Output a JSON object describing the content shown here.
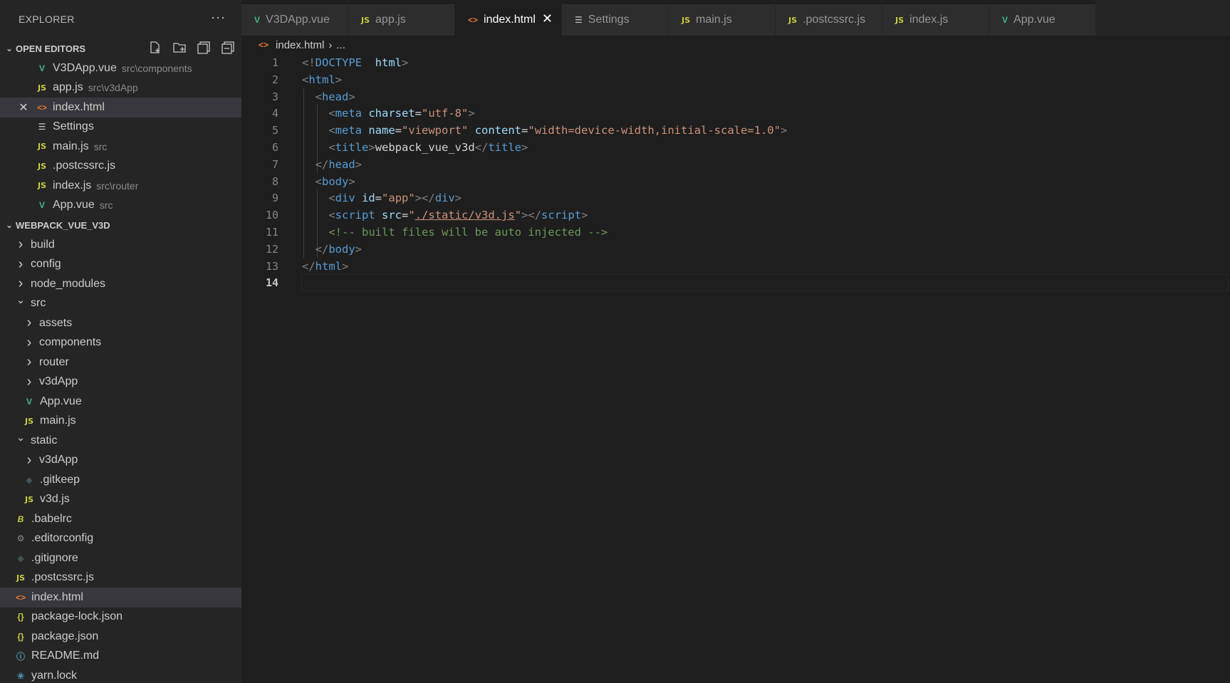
{
  "explorer": {
    "title": "EXPLORER",
    "more_label": "···",
    "open_editors": {
      "title": "OPEN EDITORS",
      "items": [
        {
          "name": "V3DApp.vue",
          "desc": "src\\components",
          "icon": "vue-icon"
        },
        {
          "name": "app.js",
          "desc": "src\\v3dApp",
          "icon": "js-icon"
        },
        {
          "name": "index.html",
          "desc": "",
          "icon": "html-icon",
          "selected": true
        },
        {
          "name": "Settings",
          "desc": "",
          "icon": "settings-icon"
        },
        {
          "name": "main.js",
          "desc": "src",
          "icon": "js-icon"
        },
        {
          "name": ".postcssrc.js",
          "desc": "",
          "icon": "js-icon"
        },
        {
          "name": "index.js",
          "desc": "src\\router",
          "icon": "js-icon"
        },
        {
          "name": "App.vue",
          "desc": "src",
          "icon": "vue-icon"
        }
      ]
    },
    "project": {
      "title": "WEBPACK_VUE_V3D",
      "tree": [
        {
          "name": "build",
          "type": "folder",
          "expanded": false,
          "depth": 0
        },
        {
          "name": "config",
          "type": "folder",
          "expanded": false,
          "depth": 0
        },
        {
          "name": "node_modules",
          "type": "folder",
          "expanded": false,
          "depth": 0
        },
        {
          "name": "src",
          "type": "folder",
          "expanded": true,
          "depth": 0
        },
        {
          "name": "assets",
          "type": "folder",
          "expanded": false,
          "depth": 1
        },
        {
          "name": "components",
          "type": "folder",
          "expanded": false,
          "depth": 1
        },
        {
          "name": "router",
          "type": "folder",
          "expanded": false,
          "depth": 1
        },
        {
          "name": "v3dApp",
          "type": "folder",
          "expanded": false,
          "depth": 1
        },
        {
          "name": "App.vue",
          "type": "file",
          "icon": "vue-icon",
          "depth": 1
        },
        {
          "name": "main.js",
          "type": "file",
          "icon": "js-icon",
          "depth": 1
        },
        {
          "name": "static",
          "type": "folder",
          "expanded": true,
          "depth": 0
        },
        {
          "name": "v3dApp",
          "type": "folder",
          "expanded": false,
          "depth": 1
        },
        {
          "name": ".gitkeep",
          "type": "file",
          "icon": "git-icon",
          "depth": 1
        },
        {
          "name": "v3d.js",
          "type": "file",
          "icon": "js-icon",
          "depth": 1
        },
        {
          "name": ".babelrc",
          "type": "file",
          "icon": "babel-icon",
          "depth": 0
        },
        {
          "name": ".editorconfig",
          "type": "file",
          "icon": "gear-icon",
          "depth": 0
        },
        {
          "name": ".gitignore",
          "type": "file",
          "icon": "git-icon",
          "depth": 0
        },
        {
          "name": ".postcssrc.js",
          "type": "file",
          "icon": "js-icon",
          "depth": 0
        },
        {
          "name": "index.html",
          "type": "file",
          "icon": "html-icon",
          "depth": 0,
          "selected": true
        },
        {
          "name": "package-lock.json",
          "type": "file",
          "icon": "json-icon",
          "depth": 0
        },
        {
          "name": "package.json",
          "type": "file",
          "icon": "json-icon",
          "depth": 0
        },
        {
          "name": "README.md",
          "type": "file",
          "icon": "info-icon",
          "depth": 0
        },
        {
          "name": "yarn.lock",
          "type": "file",
          "icon": "yarn-icon",
          "depth": 0
        }
      ]
    }
  },
  "tabs": [
    {
      "label": "V3DApp.vue",
      "icon": "vue-icon"
    },
    {
      "label": "app.js",
      "icon": "js-icon"
    },
    {
      "label": "index.html",
      "icon": "html-icon",
      "active": true
    },
    {
      "label": "Settings",
      "icon": "settings-icon"
    },
    {
      "label": "main.js",
      "icon": "js-icon"
    },
    {
      "label": ".postcssrc.js",
      "icon": "js-icon"
    },
    {
      "label": "index.js",
      "icon": "js-icon"
    },
    {
      "label": "App.vue",
      "icon": "vue-icon"
    }
  ],
  "breadcrumb": {
    "file": "index.html",
    "rest": "..."
  },
  "editor": {
    "current_line": 14,
    "lines": [
      [
        [
          "tg",
          "<!"
        ],
        [
          "tn",
          "DOCTYPE"
        ],
        [
          "",
          "  "
        ],
        [
          "an",
          "html"
        ],
        [
          "tg",
          ">"
        ]
      ],
      [
        [
          "tg",
          "<"
        ],
        [
          "tn",
          "html"
        ],
        [
          "tg",
          ">"
        ]
      ],
      [
        [
          "",
          "  "
        ],
        [
          "tg",
          "<"
        ],
        [
          "tn",
          "head"
        ],
        [
          "tg",
          ">"
        ]
      ],
      [
        [
          "",
          "    "
        ],
        [
          "tg",
          "<"
        ],
        [
          "tn",
          "meta"
        ],
        [
          "",
          " "
        ],
        [
          "an",
          "charset"
        ],
        [
          "",
          "="
        ],
        [
          "av",
          "\"utf-8\""
        ],
        [
          "tg",
          ">"
        ]
      ],
      [
        [
          "",
          "    "
        ],
        [
          "tg",
          "<"
        ],
        [
          "tn",
          "meta"
        ],
        [
          "",
          " "
        ],
        [
          "an",
          "name"
        ],
        [
          "",
          "="
        ],
        [
          "av",
          "\"viewport\""
        ],
        [
          "",
          " "
        ],
        [
          "an",
          "content"
        ],
        [
          "",
          "="
        ],
        [
          "av",
          "\"width=device-width,initial-scale=1.0\""
        ],
        [
          "tg",
          ">"
        ]
      ],
      [
        [
          "",
          "    "
        ],
        [
          "tg",
          "<"
        ],
        [
          "tn",
          "title"
        ],
        [
          "tg",
          ">"
        ],
        [
          "",
          "webpack_vue_v3d"
        ],
        [
          "tg",
          "</"
        ],
        [
          "tn",
          "title"
        ],
        [
          "tg",
          ">"
        ]
      ],
      [
        [
          "",
          "  "
        ],
        [
          "tg",
          "</"
        ],
        [
          "tn",
          "head"
        ],
        [
          "tg",
          ">"
        ]
      ],
      [
        [
          "",
          "  "
        ],
        [
          "tg",
          "<"
        ],
        [
          "tn",
          "body"
        ],
        [
          "tg",
          ">"
        ]
      ],
      [
        [
          "",
          "    "
        ],
        [
          "tg",
          "<"
        ],
        [
          "tn",
          "div"
        ],
        [
          "",
          " "
        ],
        [
          "an",
          "id"
        ],
        [
          "",
          "="
        ],
        [
          "av",
          "\"app\""
        ],
        [
          "tg",
          "></"
        ],
        [
          "tn",
          "div"
        ],
        [
          "tg",
          ">"
        ]
      ],
      [
        [
          "",
          "    "
        ],
        [
          "tg",
          "<"
        ],
        [
          "tn",
          "script"
        ],
        [
          "",
          " "
        ],
        [
          "an",
          "src"
        ],
        [
          "",
          "="
        ],
        [
          "av",
          "\""
        ],
        [
          "av link",
          "./static/v3d.js"
        ],
        [
          "av",
          "\""
        ],
        [
          "tg",
          "></"
        ],
        [
          "tn",
          "script"
        ],
        [
          "tg",
          ">"
        ]
      ],
      [
        [
          "",
          "    "
        ],
        [
          "cm",
          "<!-- built files will be auto injected -->"
        ]
      ],
      [
        [
          "",
          "  "
        ],
        [
          "tg",
          "</"
        ],
        [
          "tn",
          "body"
        ],
        [
          "tg",
          ">"
        ]
      ],
      [
        [
          "tg",
          "</"
        ],
        [
          "tn",
          "html"
        ],
        [
          "tg",
          ">"
        ]
      ],
      []
    ]
  }
}
